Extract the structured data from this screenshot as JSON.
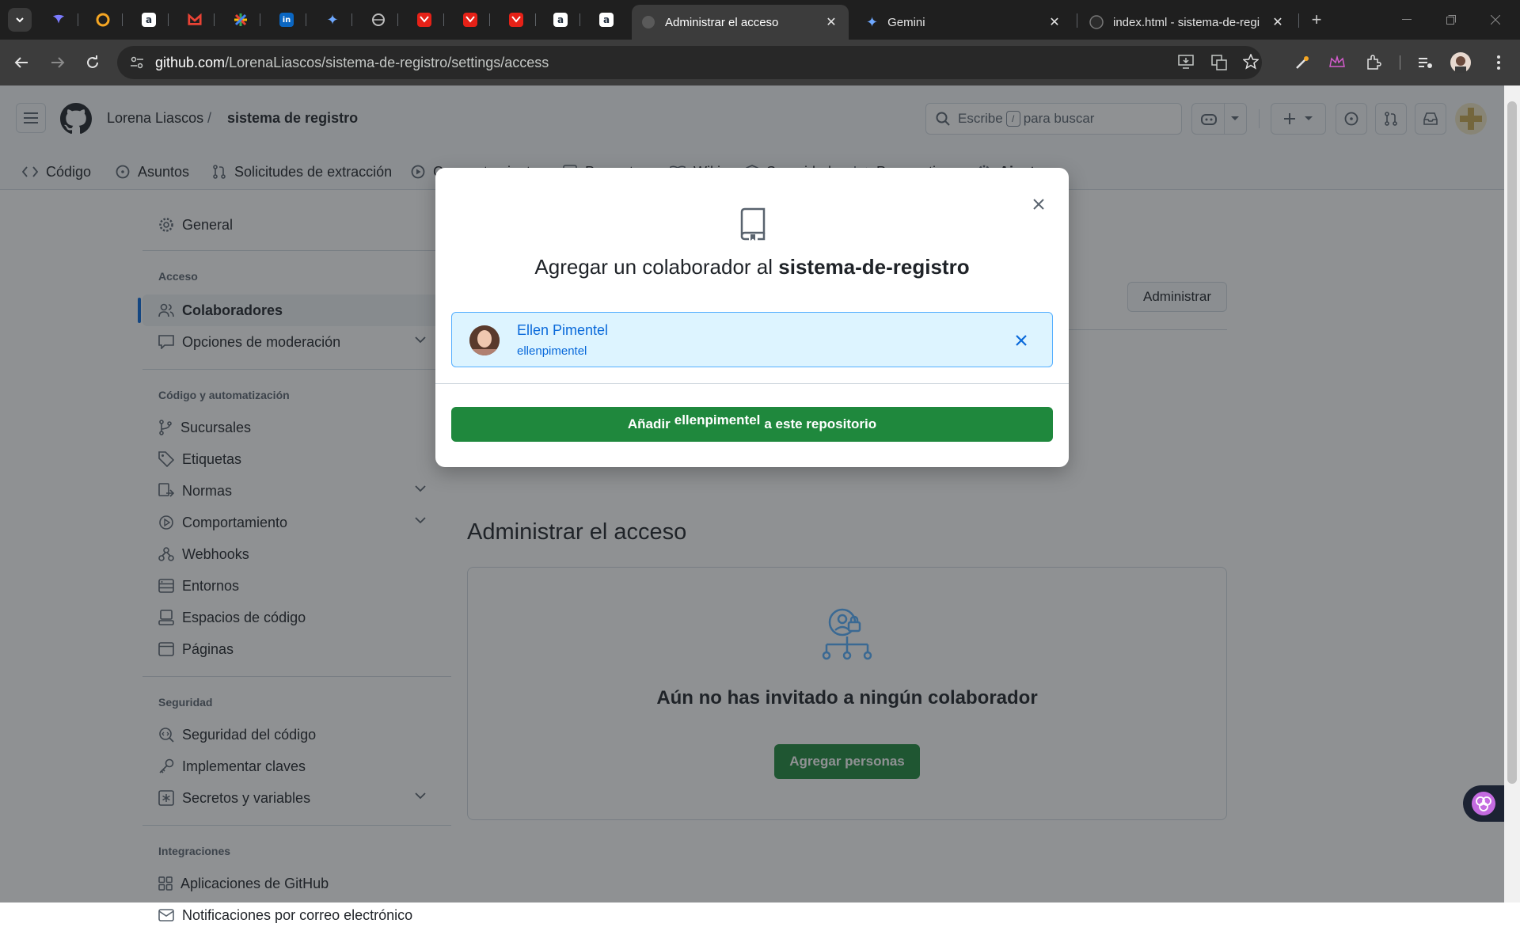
{
  "browser": {
    "tabs": [
      {
        "title": "Administrar el acceso",
        "active": true
      },
      {
        "title": "Gemini",
        "active": false
      },
      {
        "title": "index.html - sistema-de-regi",
        "active": false
      }
    ],
    "pinned_letters": {
      "amazon": "a",
      "linkedin": "in"
    },
    "new_tab": "+",
    "url_host": "github.com",
    "url_path": "/LorenaLiascos/sistema-de-registro/settings/access"
  },
  "header": {
    "owner": "Lorena Liascos",
    "separator": "/",
    "repo": "sistema de registro",
    "search_before": "Escribe",
    "search_key": "/",
    "search_after": "para buscar"
  },
  "repo_nav": [
    "Código",
    "Asuntos",
    "Solicitudes de extracción",
    "Comportamiento",
    "Proyectos",
    "Wiki",
    "Seguridad",
    "Perspectivas",
    "Ajustes"
  ],
  "sidebar": {
    "general": "General",
    "access_heading": "Acceso",
    "collaborators": "Colaboradores",
    "moderation": "Opciones de moderación",
    "code_heading": "Código y automatización",
    "branches": "Sucursales",
    "tags": "Etiquetas",
    "rules": "Normas",
    "actions": "Comportamiento",
    "webhooks": "Webhooks",
    "environments": "Entornos",
    "codespaces": "Espacios de código",
    "pages": "Páginas",
    "security_heading": "Seguridad",
    "code_security": "Seguridad del código",
    "deploy_keys": "Implementar claves",
    "secrets": "Secretos y variables",
    "integrations_heading": "Integraciones",
    "github_apps": "Aplicaciones de GitHub",
    "email_notifications": "Notificaciones por correo electrónico"
  },
  "main": {
    "manage_button": "Administrar",
    "access_title": "Administrar el acceso",
    "empty_title": "Aún no has invitado a ningún colaborador",
    "add_people_button": "Agregar personas"
  },
  "dialog": {
    "title_prefix": "Agregar un colaborador al",
    "title_repo": "sistema-de-registro",
    "user_name": "Ellen Pimentel",
    "user_login": "ellenpimentel",
    "button_prefix": "Añadir",
    "button_login": "ellenpimentel",
    "button_suffix": "a este repositorio"
  },
  "colors": {
    "accent_blue": "#0969da",
    "primary_green": "#1f883d",
    "chip_bg": "#ddf4ff"
  }
}
